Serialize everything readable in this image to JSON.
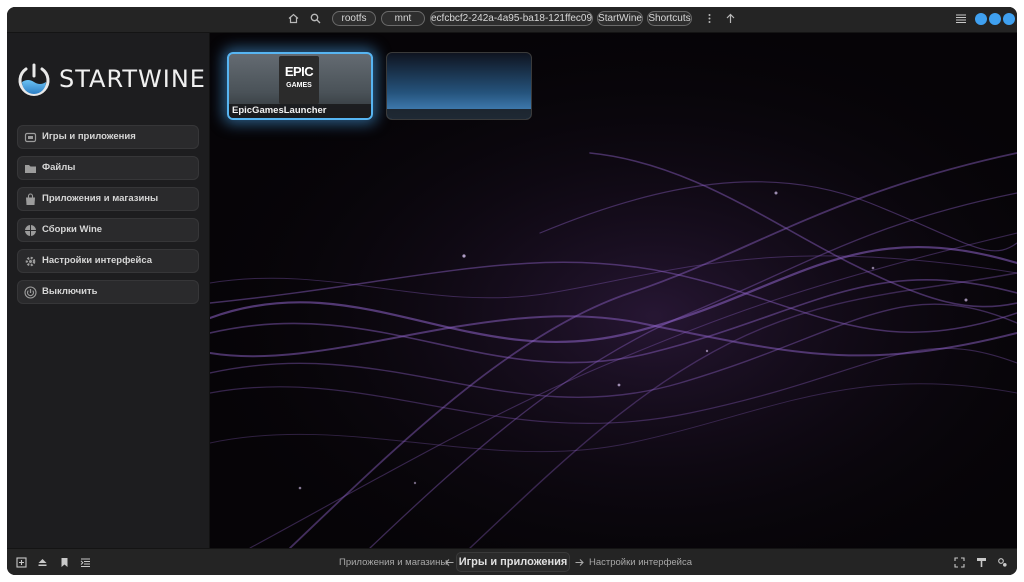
{
  "header": {
    "breadcrumbs": [
      "rootfs",
      "mnt",
      "ecfcbcf2-242a-4a95-ba18-121ffec09ccc",
      "StartWine",
      "Shortcuts"
    ],
    "icons": [
      "home-icon",
      "search-icon",
      "more-vertical-icon",
      "arrow-up-icon",
      "hamburger-menu-icon"
    ],
    "window_controls_color": "#3fa0f0"
  },
  "sidebar": {
    "logo_text": "STARTWINE",
    "items": [
      {
        "label": "Игры и приложения",
        "icon": "games-icon"
      },
      {
        "label": "Файлы",
        "icon": "folder-icon"
      },
      {
        "label": "Приложения и магазины",
        "icon": "store-bag-icon"
      },
      {
        "label": "Сборки Wine",
        "icon": "wine-globe-icon"
      },
      {
        "label": "Настройки интерфейса",
        "icon": "gear-icon"
      },
      {
        "label": "Выключить",
        "icon": "power-icon"
      }
    ]
  },
  "main": {
    "cards": [
      {
        "caption": "EpicGamesLauncher",
        "logo_line1": "EPIC",
        "logo_line2": "GAMES",
        "selected": true
      },
      {
        "caption": "",
        "selected": false
      }
    ],
    "accent_color": "#57b5f2"
  },
  "bottombar": {
    "prev_page": "Приложения и магазины",
    "current_page": "Игры и приложения",
    "next_page": "Настройки интерфейса",
    "left_icons": [
      "add-tile-icon",
      "eject-icon",
      "bookmark-icon",
      "list-indent-icon"
    ],
    "right_icons": [
      "fullscreen-icon",
      "paint-roller-icon",
      "settings-cog-icon"
    ]
  }
}
